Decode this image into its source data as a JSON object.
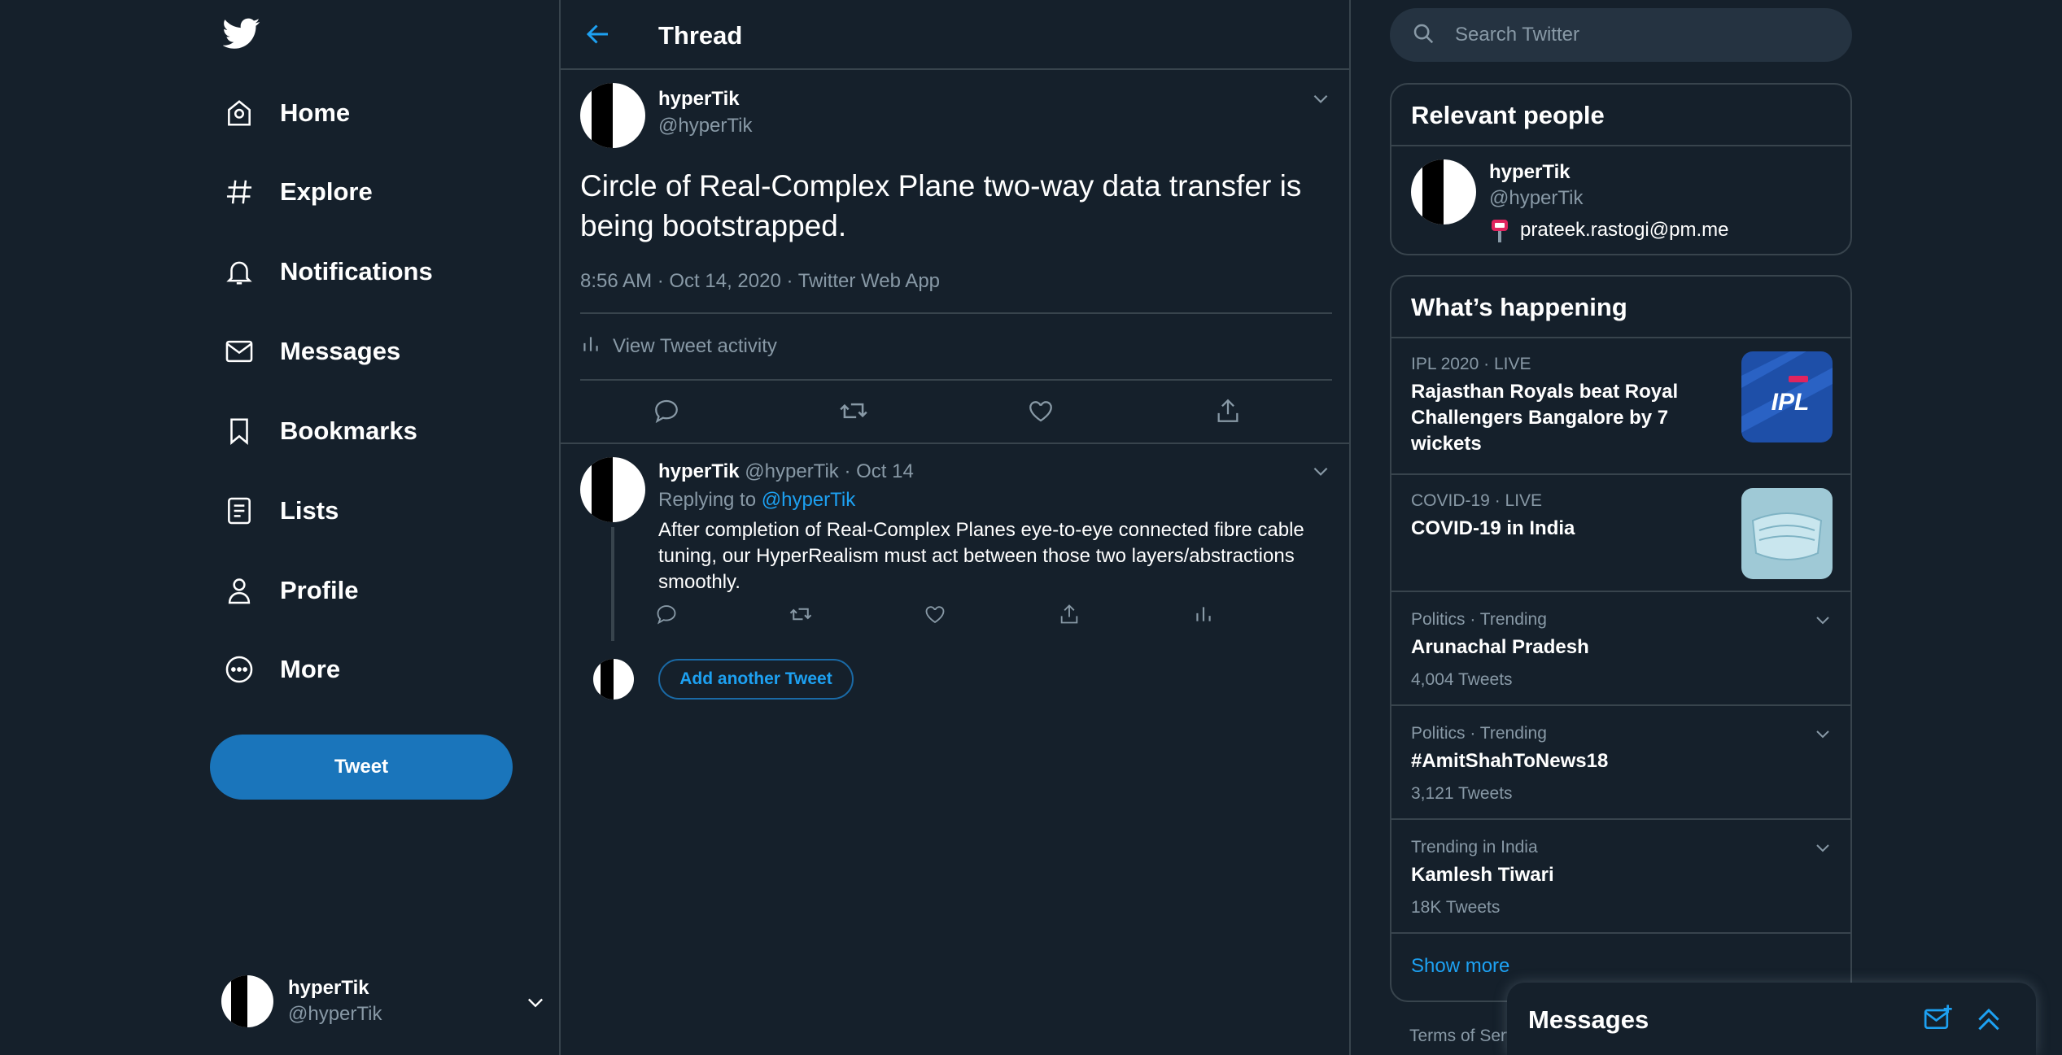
{
  "nav": {
    "items": [
      {
        "label": "Home",
        "icon": "home-icon"
      },
      {
        "label": "Explore",
        "icon": "hashtag-icon"
      },
      {
        "label": "Notifications",
        "icon": "bell-icon"
      },
      {
        "label": "Messages",
        "icon": "envelope-icon"
      },
      {
        "label": "Bookmarks",
        "icon": "bookmark-icon"
      },
      {
        "label": "Lists",
        "icon": "list-icon"
      },
      {
        "label": "Profile",
        "icon": "person-icon"
      },
      {
        "label": "More",
        "icon": "more-circle-icon"
      }
    ],
    "tweet_button": "Tweet"
  },
  "account": {
    "name": "hyperTik",
    "handle": "@hyperTik"
  },
  "thread": {
    "title": "Thread",
    "main_tweet": {
      "name": "hyperTik",
      "handle": "@hyperTik",
      "text": "Circle of Real-Complex Plane two-way data transfer is being bootstrapped.",
      "meta": "8:56 AM · Oct 14, 2020 · Twitter Web App",
      "activity": "View Tweet activity"
    },
    "reply": {
      "name": "hyperTik",
      "handle_date": "@hyperTik · Oct 14",
      "replying_prefix": "Replying to",
      "replying_handle": "@hyperTik",
      "text": "After completion of Real-Complex Planes eye-to-eye connected fibre cable tuning, our HyperRealism must act between those two layers/abstractions smoothly."
    },
    "add_button": "Add another Tweet"
  },
  "search": {
    "placeholder": "Search Twitter"
  },
  "relevant": {
    "title": "Relevant people",
    "person": {
      "name": "hyperTik",
      "handle": "@hyperTik",
      "bio": "prateek.rastogi@pm.me"
    }
  },
  "happening": {
    "title": "What’s happening",
    "trends": [
      {
        "context": "IPL 2020 · LIVE",
        "title": "Rajasthan Royals beat Royal Challengers Bangalore by 7 wickets",
        "thumb": "ipl-logo"
      },
      {
        "context": "COVID-19 · LIVE",
        "title": "COVID-19 in India",
        "thumb": "face-mask"
      },
      {
        "context": "Politics · Trending",
        "title": "Arunachal Pradesh",
        "count": "4,004 Tweets"
      },
      {
        "context": "Politics · Trending",
        "title": "#AmitShahToNews18",
        "count": "3,121 Tweets"
      },
      {
        "context": "Trending in India",
        "title": "Kamlesh Tiwari",
        "count": "18K Tweets"
      }
    ],
    "show_more": "Show more"
  },
  "footer": {
    "terms": "Terms of Serv"
  },
  "messages_dock": {
    "title": "Messages"
  },
  "colors": {
    "background": "#15202b",
    "accent": "#1da1f2",
    "tweet_button": "#1a75bb",
    "muted": "#8899a6",
    "border": "#38444d"
  }
}
